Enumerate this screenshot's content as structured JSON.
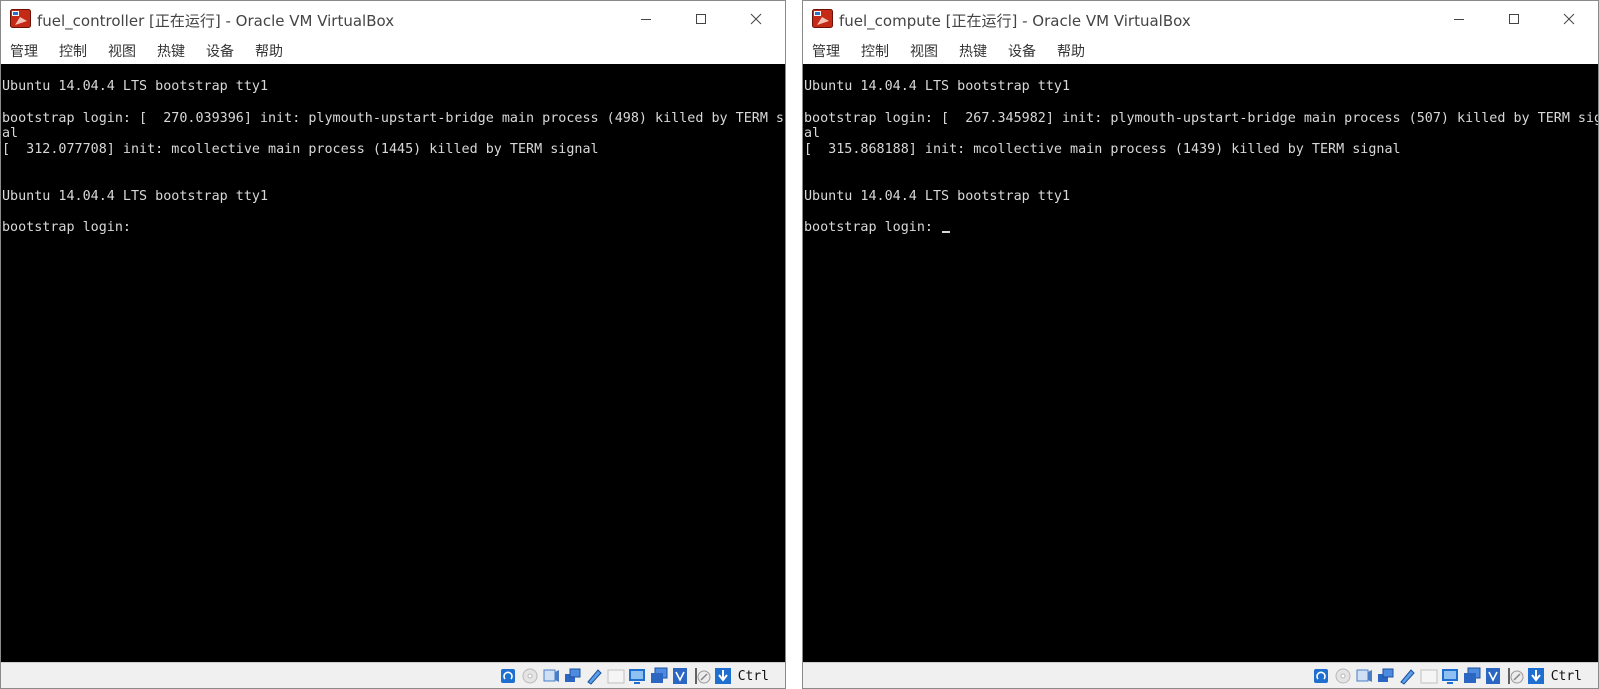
{
  "windows": [
    {
      "title": "fuel_controller [正在运行] - Oracle VM VirtualBox",
      "menu": [
        "管理",
        "控制",
        "视图",
        "热键",
        "设备",
        "帮助"
      ],
      "console_lines": [
        "Ubuntu 14.04.4 LTS bootstrap tty1",
        "bootstrap login: [  270.039396] init: plymouth-upstart-bridge main process (498) killed by TERM sign",
        "al",
        "[  312.077708] init: mcollective main process (1445) killed by TERM signal",
        "Ubuntu 14.04.4 LTS bootstrap tty1",
        "bootstrap login: "
      ],
      "host_key": "Ctrl"
    },
    {
      "title": "fuel_compute [正在运行] - Oracle VM VirtualBox",
      "menu": [
        "管理",
        "控制",
        "视图",
        "热键",
        "设备",
        "帮助"
      ],
      "console_lines": [
        "Ubuntu 14.04.4 LTS bootstrap tty1",
        "bootstrap login: [  267.345982] init: plymouth-upstart-bridge main process (507) killed by TERM sign",
        "al",
        "[  315.868188] init: mcollective main process (1439) killed by TERM signal",
        "Ubuntu 14.04.4 LTS bootstrap tty1",
        "bootstrap login: "
      ],
      "host_key": "Ctrl"
    }
  ],
  "status_icon_names": [
    "hard-disk-icon",
    "optical-drive-icon",
    "audio-icon",
    "network-icon",
    "usb-icon",
    "shared-folders-icon",
    "display-icon",
    "video-capture-icon",
    "virtualization-icon",
    "mouse-integration-icon",
    "keyboard-capture-icon"
  ],
  "colors": {
    "console_bg": "#000000",
    "console_text": "#d8d8d8",
    "titlebar_bg": "#ffffff",
    "statusbar_bg": "#f0f0f0",
    "icon_blue": "#1f6fd0"
  }
}
